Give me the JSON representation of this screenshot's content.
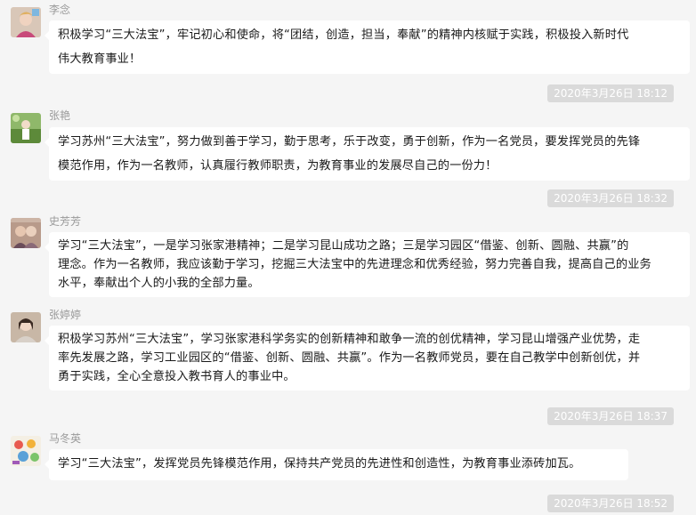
{
  "messages": [
    {
      "name": "李念",
      "lines": [
        "积极学习“三大法宝”，牢记初心和使命，将“团结，创造，担当，奉献”的精神内核赋于实践，积极投入新时代",
        "伟大教育事业！"
      ],
      "time": "2020年3月26日 18:12",
      "avatar_icon": "user-avatar-icon"
    },
    {
      "name": "张艳",
      "lines": [
        "学习苏州“三大法宝”，努力做到善于学习，勤于思考，乐于改变，勇于创新，作为一名党员，要发挥党员的先锋",
        "模范作用，作为一名教师，认真履行教师职责，为教育事业的发展尽自己的一份力！"
      ],
      "time": "2020年3月26日 18:32",
      "avatar_icon": "user-avatar-icon"
    },
    {
      "name": "史芳芳",
      "lines": [
        "学习“三大法宝”，一是学习张家港精神；二是学习昆山成功之路；三是学习园区“借鉴、创新、圆融、共赢”的",
        "理念。作为一名教师，我应该勤于学习，挖掘三大法宝中的先进理念和优秀经验，努力完善自我，提高自己的业务",
        "水平，奉献出个人的小我的全部力量。"
      ],
      "time": "",
      "avatar_icon": "user-avatar-icon"
    },
    {
      "name": "张婷婷",
      "lines": [
        "积极学习苏州“三大法宝”，学习张家港科学务实的创新精神和敢争一流的创优精神，学习昆山增强产业优势，走",
        "率先发展之路，学习工业园区的“借鉴、创新、圆融、共赢”。作为一名教师党员，要在自己教学中创新创优，并",
        "勇于实践，全心全意投入教书育人的事业中。"
      ],
      "time": "2020年3月26日 18:37",
      "avatar_icon": "user-avatar-icon"
    },
    {
      "name": "马冬英",
      "lines": [
        "学习“三大法宝”，发挥党员先锋模范作用，保持共产党员的先进性和创造性，为教育事业添砖加瓦。"
      ],
      "time": "2020年3月26日 18:52",
      "avatar_icon": "user-avatar-icon"
    }
  ]
}
